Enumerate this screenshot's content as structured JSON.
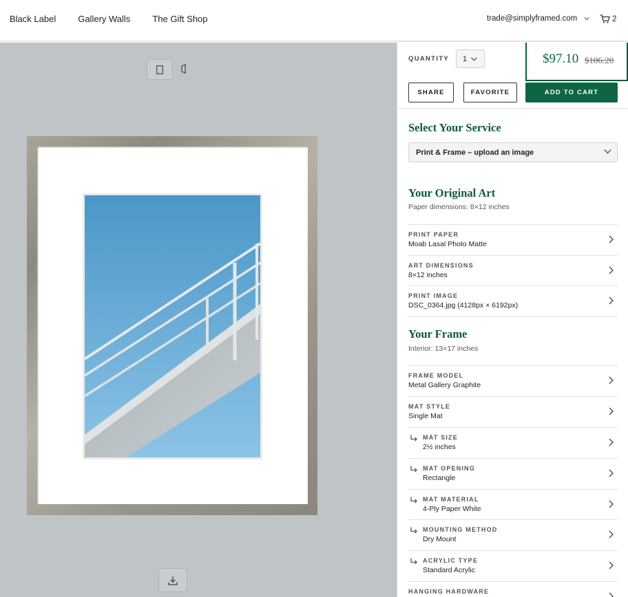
{
  "nav": {
    "links": [
      "Black Label",
      "Gallery Walls",
      "The Gift Shop"
    ],
    "account_email": "trade@simplyframed.com",
    "cart_count": "2"
  },
  "purchase": {
    "quantity_label": "QUANTITY",
    "quantity_value": "1",
    "price": "$97.10",
    "price_original": "$106.20",
    "share_label": "SHARE",
    "favorite_label": "FAVORITE",
    "add_to_cart_label": "ADD TO CART"
  },
  "service": {
    "heading": "Select Your Service",
    "selected": "Print & Frame – upload an image"
  },
  "original_art": {
    "heading": "Your Original Art",
    "subtitle": "Paper dimensions: 8×12 inches",
    "rows": [
      {
        "label": "PRINT PAPER",
        "value": "Moab Lasal Photo Matte"
      },
      {
        "label": "ART DIMENSIONS",
        "value": "8×12 inches"
      },
      {
        "label": "PRINT IMAGE",
        "value": "DSC_0364.jpg (4128px × 6192px)"
      }
    ]
  },
  "frame": {
    "heading": "Your Frame",
    "subtitle": "Interior: 13×17 inches",
    "rows": [
      {
        "label": "FRAME MODEL",
        "value": "Metal Gallery Graphite"
      },
      {
        "label": "MAT STYLE",
        "value": "Single Mat"
      },
      {
        "label": "MAT SIZE",
        "value": "2½ inches"
      },
      {
        "label": "MAT OPENING",
        "value": "Rectangle"
      },
      {
        "label": "MAT MATERIAL",
        "value": "4-Ply Paper White"
      },
      {
        "label": "MOUNTING METHOD",
        "value": "Dry Mount"
      },
      {
        "label": "ACRYLIC TYPE",
        "value": "Standard Acrylic"
      },
      {
        "label": "HANGING HARDWARE",
        "value": ""
      }
    ]
  },
  "colors": {
    "brand_green": "#0d6641",
    "preview_bg": "#bfc4c7"
  }
}
